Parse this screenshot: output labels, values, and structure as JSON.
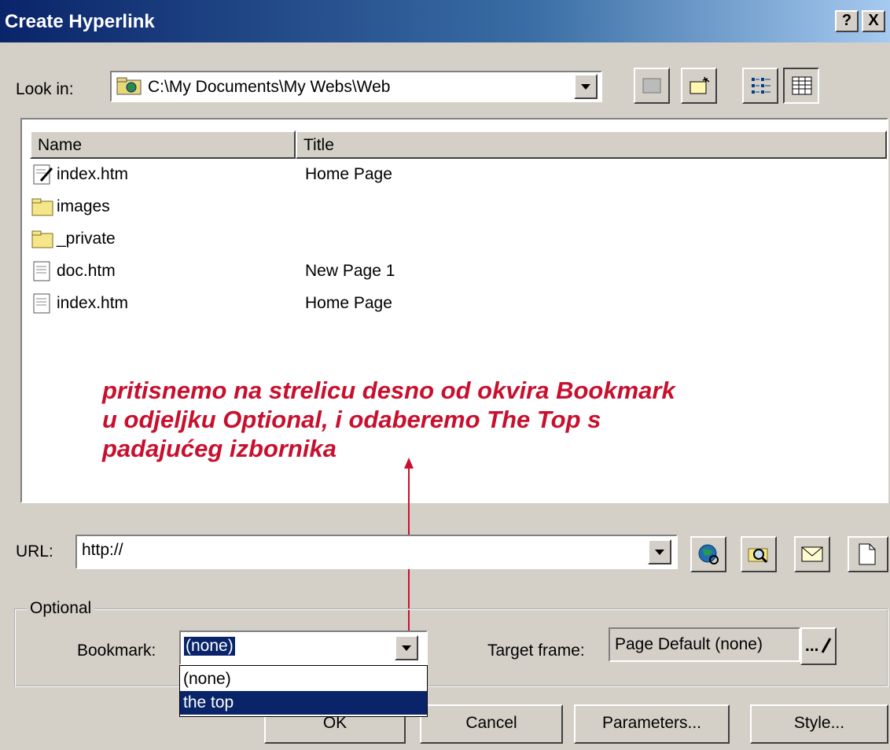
{
  "window": {
    "title": "Create Hyperlink",
    "help_glyph": "?",
    "close_glyph": "X"
  },
  "look_in": {
    "label": "Look in:",
    "path": "C:\\My Documents\\My Webs\\Web"
  },
  "file_list": {
    "columns": [
      "Name",
      "Title"
    ],
    "rows": [
      {
        "name": "index.htm",
        "title": "Home Page",
        "icon": "edit-page-icon"
      },
      {
        "name": "images",
        "title": "",
        "icon": "folder-icon"
      },
      {
        "name": "_private",
        "title": "",
        "icon": "folder-icon"
      },
      {
        "name": "doc.htm",
        "title": "New Page 1",
        "icon": "page-icon"
      },
      {
        "name": "index.htm",
        "title": "Home Page",
        "icon": "page-icon"
      }
    ]
  },
  "annotation": {
    "text_line1": "pritisnemo na strelicu desno od okvira Bookmark",
    "text_line2": "u odjeljku Optional, i odaberemo The Top s",
    "text_line3": "padajućeg izbornika",
    "color": "#c8102e"
  },
  "url": {
    "label": "URL:",
    "value": "http://"
  },
  "optional": {
    "group_label": "Optional",
    "bookmark_label": "Bookmark:",
    "bookmark_value": "(none)",
    "bookmark_options": [
      "(none)",
      "the top"
    ],
    "bookmark_highlighted_option": "the top",
    "target_label": "Target frame:",
    "target_value": "Page Default (none)",
    "target_button_label": "..."
  },
  "buttons": {
    "ok": "OK",
    "cancel": "Cancel",
    "parameters": "Parameters...",
    "style": "Style..."
  },
  "colors": {
    "title_bar": "#0a246a",
    "selection": "#0a246a",
    "face": "#d4d0c8"
  }
}
